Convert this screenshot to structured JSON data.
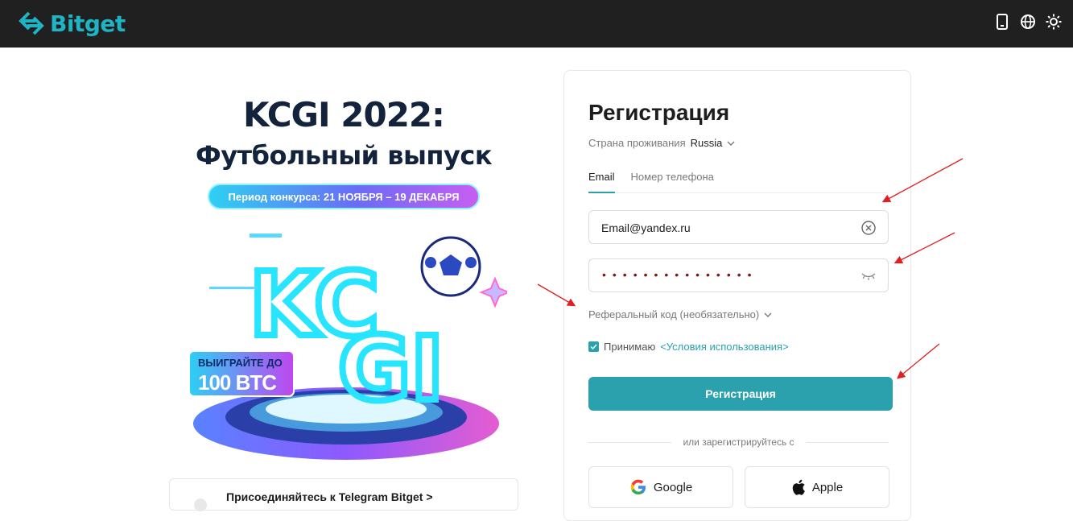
{
  "header": {
    "brand": "Bitget",
    "icons": [
      "mobile-icon",
      "globe-icon",
      "theme-sun-icon"
    ]
  },
  "promo": {
    "title": "KCGI 2022:",
    "subtitle": "Футбольный выпуск",
    "period": "Период конкурса: 21 НОЯБРЯ – 19 ДЕКАБРЯ",
    "badge_line1": "ВЫИГРАЙТЕ ДО",
    "badge_line2": "100 BTC",
    "art_letters": "KCGI",
    "telegram": "Присоединяйтесь к Telegram Bitget >"
  },
  "register": {
    "title": "Регистрация",
    "country_label": "Страна проживания",
    "country_value": "Russia",
    "tabs": [
      {
        "label": "Email",
        "active": true
      },
      {
        "label": "Номер телефона",
        "active": false
      }
    ],
    "email_value": "Email@yandex.ru",
    "password_mask": "•••••••••••••••",
    "referral_label": "Реферальный код (необязательно)",
    "agree_text": "Принимаю",
    "terms_link": "<Условия использования>",
    "submit_label": "Регистрация",
    "or_label": "или зарегистрируйтесь с",
    "google_label": "Google",
    "apple_label": "Apple"
  },
  "colors": {
    "accent": "#2aa1ad",
    "brand": "#1fb4c4",
    "header_bg": "#202020",
    "annotation": "#e02020"
  }
}
